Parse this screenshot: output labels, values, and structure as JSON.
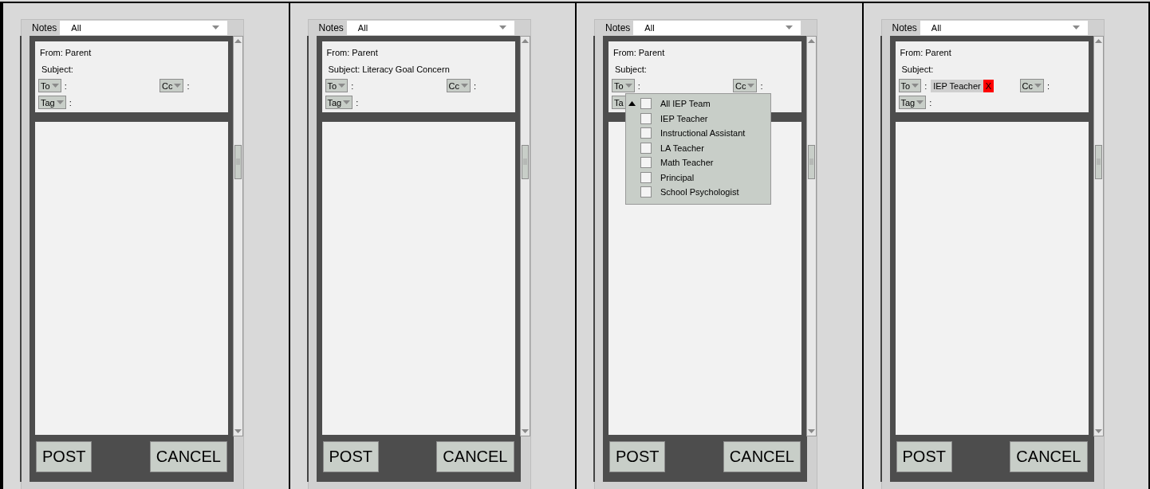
{
  "panels": [
    {
      "filter": {
        "label": "Notes",
        "value": "All"
      },
      "from": "From: Parent",
      "subject": "Subject:",
      "to": {
        "label": "To",
        "separator": ":"
      },
      "cc": {
        "label": "Cc",
        "separator": ":"
      },
      "tag": {
        "label": "Tag",
        "separator": ":"
      },
      "buttons": [
        "POST",
        "CANCEL"
      ]
    },
    {
      "filter": {
        "label": "Notes",
        "value": "All"
      },
      "from": "From: Parent",
      "subject": "Subject: Literacy Goal Concern",
      "to": {
        "label": "To",
        "separator": ":"
      },
      "cc": {
        "label": "Cc",
        "separator": ":"
      },
      "tag": {
        "label": "Tag",
        "separator": ":"
      },
      "buttons": [
        "POST",
        "CANCEL"
      ]
    },
    {
      "filter": {
        "label": "Notes",
        "value": "All"
      },
      "from": "From: Parent",
      "subject": "Subject:",
      "to": {
        "label": "To",
        "separator": ":",
        "options": [
          {
            "label": "All IEP Team",
            "checked": false
          },
          {
            "label": "IEP Teacher",
            "checked": false
          },
          {
            "label": "Instructional Assistant",
            "checked": false
          },
          {
            "label": "LA Teacher",
            "checked": false
          },
          {
            "label": "Math Teacher",
            "checked": false
          },
          {
            "label": "Principal",
            "checked": false
          },
          {
            "label": "School Psychologist",
            "checked": false
          }
        ]
      },
      "cc": {
        "label": "Cc",
        "separator": ":"
      },
      "tag": {
        "label": "Ta"
      },
      "buttons": [
        "POST",
        "CANCEL"
      ]
    },
    {
      "filter": {
        "label": "Notes",
        "value": "All"
      },
      "from": "From: Parent",
      "subject": "Subject:",
      "to": {
        "label": "To",
        "separator": ":",
        "recipients": [
          {
            "label": "IEP Teacher",
            "remove": "X"
          }
        ]
      },
      "cc": {
        "label": "Cc",
        "separator": ":"
      },
      "tag": {
        "label": "Tag",
        "separator": ":"
      },
      "buttons": [
        "POST",
        "CANCEL"
      ]
    }
  ]
}
